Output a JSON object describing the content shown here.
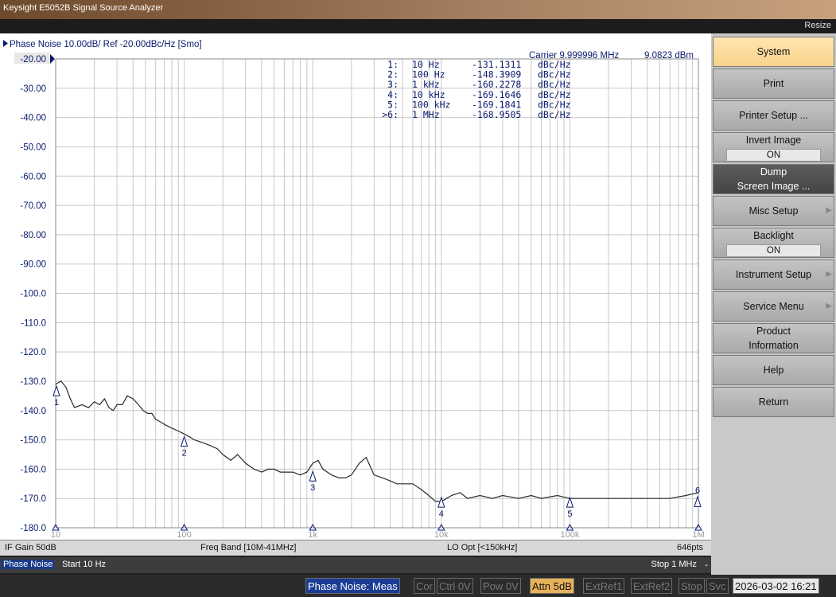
{
  "window": {
    "title": "Keysight E5052B Signal Source Analyzer",
    "resize_label": "Resize"
  },
  "trace": {
    "header": "Phase Noise 10.00dB/ Ref -20.00dBc/Hz [Smo]",
    "carrier_label": "Carrier 9.999996 MHz",
    "carrier_power": "9.0823 dBm",
    "ref_label": "-20.00",
    "y_tick_labels": [
      "-20.00",
      "-30.00",
      "-40.00",
      "-50.00",
      "-60.00",
      "-70.00",
      "-80.00",
      "-90.00",
      "-100.0",
      "-110.0",
      "-120.0",
      "-130.0",
      "-140.0",
      "-150.0",
      "-160.0",
      "-170.0",
      "-180.0"
    ],
    "x_tick_labels": [
      "10",
      "100",
      "1k",
      "10k",
      "100k",
      "1M"
    ]
  },
  "markers": [
    {
      "id": "1",
      "row_prefix": "1:",
      "offset": "10 Hz",
      "value": "-131.1311",
      "unit": "dBc/Hz"
    },
    {
      "id": "2",
      "row_prefix": "2:",
      "offset": "100 Hz",
      "value": "-148.3909",
      "unit": "dBc/Hz"
    },
    {
      "id": "3",
      "row_prefix": "3:",
      "offset": "1 kHz",
      "value": "-160.2278",
      "unit": "dBc/Hz"
    },
    {
      "id": "4",
      "row_prefix": "4:",
      "offset": "10 kHz",
      "value": "-169.1646",
      "unit": "dBc/Hz"
    },
    {
      "id": "5",
      "row_prefix": "5:",
      "offset": "100 kHz",
      "value": "-169.1841",
      "unit": "dBc/Hz"
    },
    {
      "id": "6",
      "row_prefix": ">6:",
      "offset": "1 MHz",
      "value": "-168.9505",
      "unit": "dBc/Hz"
    }
  ],
  "info_bar": {
    "if_gain": "IF Gain 50dB",
    "freq_band": "Freq Band [10M-41MHz]",
    "lo_opt": "LO Opt [<150kHz]",
    "points": "646pts"
  },
  "range_bar": {
    "meas_type": "Phase Noise",
    "start": "Start 10 Hz",
    "stop": "Stop 1 MHz",
    "dash": "-"
  },
  "status_bar": {
    "mode": "Phase Noise: Meas",
    "cor": "Cor",
    "ctrl": "Ctrl  0V",
    "pow": "Pow  0V",
    "attn": "Attn 5dB",
    "extref1": "ExtRef1",
    "extref2": "ExtRef2",
    "stop": "Stop",
    "svc": "Svc",
    "datetime": "2026-03-02 16:21"
  },
  "softkeys": [
    {
      "key": "system",
      "label": "System"
    },
    {
      "key": "print",
      "label": "Print"
    },
    {
      "key": "printer_setup",
      "label": "Printer Setup ..."
    },
    {
      "key": "invert_image",
      "label": "Invert Image",
      "value": "ON"
    },
    {
      "key": "dump_screen",
      "label": "Dump",
      "label2": "Screen Image ..."
    },
    {
      "key": "misc_setup",
      "label": "Misc Setup"
    },
    {
      "key": "backlight",
      "label": "Backlight",
      "value": "ON"
    },
    {
      "key": "instrument_setup",
      "label": "Instrument Setup"
    },
    {
      "key": "service_menu",
      "label": "Service Menu"
    },
    {
      "key": "product_info",
      "label": "Product",
      "label2": "Information"
    },
    {
      "key": "help",
      "label": "Help"
    },
    {
      "key": "return",
      "label": "Return"
    }
  ],
  "chart_data": {
    "type": "line",
    "x_scale": "log",
    "x_unit": "Hz",
    "xlim": [
      10,
      1000000
    ],
    "ylim": [
      -180,
      -20
    ],
    "y_unit": "dBc/Hz",
    "grid": true,
    "series": [
      {
        "x": [
          10,
          11,
          12,
          13,
          14,
          16,
          18,
          20,
          22,
          24,
          26,
          28,
          30,
          33,
          36,
          40,
          44,
          48,
          52,
          56,
          60,
          66,
          72,
          80,
          90,
          100,
          110,
          120,
          140,
          160,
          180,
          200,
          230,
          260,
          300,
          350,
          400,
          450,
          500,
          560,
          630,
          700,
          800,
          900,
          1000,
          1100,
          1200,
          1400,
          1600,
          1800,
          2000,
          2300,
          2600,
          3000,
          3500,
          4000,
          4500,
          5000,
          5500,
          6000,
          7000,
          8000,
          9000,
          10000,
          11000,
          12000,
          14000,
          16000,
          20000,
          25000,
          30000,
          40000,
          50000,
          60000,
          80000,
          100000,
          130000,
          160000,
          200000,
          300000,
          400000,
          500000,
          600000,
          800000,
          1000000
        ],
        "y": [
          -131,
          -130,
          -132,
          -136,
          -139,
          -138,
          -139,
          -137,
          -138,
          -136,
          -139,
          -140,
          -138,
          -138,
          -135,
          -136,
          -138,
          -140,
          -141,
          -141,
          -143,
          -144,
          -145,
          -146,
          -147,
          -148,
          -149,
          -150,
          -151,
          -152,
          -153,
          -155,
          -157,
          -155,
          -158,
          -160,
          -161,
          -160,
          -160,
          -161,
          -161,
          -161,
          -162,
          -161,
          -158,
          -157,
          -160,
          -162,
          -163,
          -163,
          -162,
          -158,
          -156,
          -162,
          -163,
          -164,
          -165,
          -165,
          -165,
          -165,
          -167,
          -169,
          -171,
          -171,
          -170,
          -169,
          -168,
          -170,
          -169,
          -170,
          -169,
          -170,
          -169,
          -170,
          -169,
          -170,
          -170,
          -170,
          -170,
          -170,
          -170,
          -170,
          -170,
          -169,
          -168
        ]
      }
    ],
    "marker_points": [
      {
        "x": 10,
        "y": -131.1311
      },
      {
        "x": 100,
        "y": -148.3909
      },
      {
        "x": 1000,
        "y": -160.2278
      },
      {
        "x": 10000,
        "y": -169.1646
      },
      {
        "x": 100000,
        "y": -169.1841
      },
      {
        "x": 1000000,
        "y": -168.9505
      }
    ]
  },
  "colors": {
    "trace": "#2a2a2a",
    "text": "#0a1a6e",
    "marker": "#0a1a6e",
    "selected_softkey": "#f8d28c",
    "attn_bg": "#e8b25a"
  }
}
